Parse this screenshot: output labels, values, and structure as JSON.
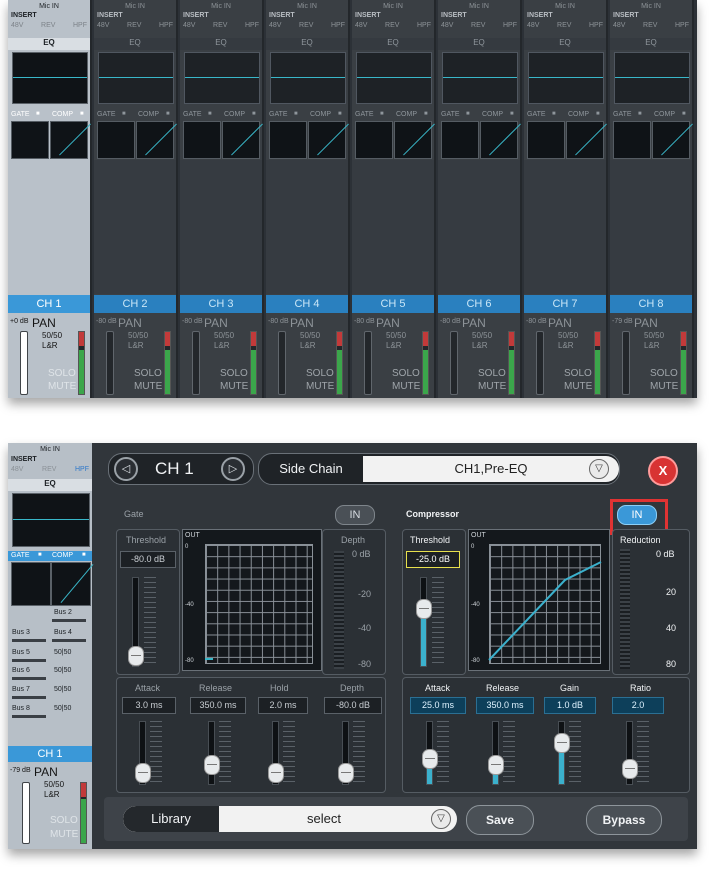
{
  "mixer": {
    "channels": [
      {
        "mic": "Mic IN",
        "insert": "INSERT",
        "v48": "48V",
        "rev": "REV",
        "hpf": "HPF",
        "eq": "EQ",
        "gate": "GATE",
        "comp": "COMP",
        "name": "CH 1",
        "db": "+0 dB",
        "pan": "PAN",
        "pan_val": "50/50",
        "pan_lr": "L&R",
        "solo": "SOLO",
        "mute": "MUTE"
      },
      {
        "mic": "Mic IN",
        "insert": "INSERT",
        "v48": "48V",
        "rev": "REV",
        "hpf": "HPF",
        "eq": "EQ",
        "gate": "GATE",
        "comp": "COMP",
        "name": "CH 2",
        "db": "-80 dB",
        "pan": "PAN",
        "pan_val": "50/50",
        "pan_lr": "L&R",
        "solo": "SOLO",
        "mute": "MUTE"
      },
      {
        "mic": "Mic IN",
        "insert": "INSERT",
        "v48": "48V",
        "rev": "REV",
        "hpf": "HPF",
        "eq": "EQ",
        "gate": "GATE",
        "comp": "COMP",
        "name": "CH 3",
        "db": "-80 dB",
        "pan": "PAN",
        "pan_val": "50/50",
        "pan_lr": "L&R",
        "solo": "SOLO",
        "mute": "MUTE"
      },
      {
        "mic": "Mic IN",
        "insert": "INSERT",
        "v48": "48V",
        "rev": "REV",
        "hpf": "HPF",
        "eq": "EQ",
        "gate": "GATE",
        "comp": "COMP",
        "name": "CH 4",
        "db": "-80 dB",
        "pan": "PAN",
        "pan_val": "50/50",
        "pan_lr": "L&R",
        "solo": "SOLO",
        "mute": "MUTE"
      },
      {
        "mic": "Mic IN",
        "insert": "INSERT",
        "v48": "48V",
        "rev": "REV",
        "hpf": "HPF",
        "eq": "EQ",
        "gate": "GATE",
        "comp": "COMP",
        "name": "CH 5",
        "db": "-80 dB",
        "pan": "PAN",
        "pan_val": "50/50",
        "pan_lr": "L&R",
        "solo": "SOLO",
        "mute": "MUTE"
      },
      {
        "mic": "Mic IN",
        "insert": "INSERT",
        "v48": "48V",
        "rev": "REV",
        "hpf": "HPF",
        "eq": "EQ",
        "gate": "GATE",
        "comp": "COMP",
        "name": "CH 6",
        "db": "-80 dB",
        "pan": "PAN",
        "pan_val": "50/50",
        "pan_lr": "L&R",
        "solo": "SOLO",
        "mute": "MUTE"
      },
      {
        "mic": "Mic IN",
        "insert": "INSERT",
        "v48": "48V",
        "rev": "REV",
        "hpf": "HPF",
        "eq": "EQ",
        "gate": "GATE",
        "comp": "COMP",
        "name": "CH 7",
        "db": "-80 dB",
        "pan": "PAN",
        "pan_val": "50/50",
        "pan_lr": "L&R",
        "solo": "SOLO",
        "mute": "MUTE"
      },
      {
        "mic": "Mic IN",
        "insert": "INSERT",
        "v48": "48V",
        "rev": "REV",
        "hpf": "HPF",
        "eq": "EQ",
        "gate": "GATE",
        "comp": "COMP",
        "name": "CH 8",
        "db": "-79 dB",
        "pan": "PAN",
        "pan_val": "50/50",
        "pan_lr": "L&R",
        "solo": "SOLO",
        "mute": "MUTE"
      }
    ]
  },
  "side": {
    "mic": "Mic IN",
    "insert": "INSERT",
    "v48": "48V",
    "rev": "REV",
    "hpf": "HPF",
    "eq": "EQ",
    "gate": "GATE",
    "comp": "COMP",
    "buses": [
      "Bus 2",
      "Bus 3",
      "Bus 4",
      "Bus 5",
      "50|50",
      "Bus 6",
      "50|50",
      "Bus 7",
      "50|50",
      "Bus 8",
      "50|50"
    ],
    "name": "CH 1",
    "db": "-79 dB",
    "pan": "PAN",
    "pan_val": "50/50",
    "pan_lr": "L&R",
    "solo": "SOLO",
    "mute": "MUTE"
  },
  "header": {
    "channel": "CH 1",
    "prev_icon": "triangle-left-icon",
    "next_icon": "triangle-right-icon",
    "sidechain_label": "Side Chain",
    "sidechain_value": "CH1,Pre-EQ",
    "close_label": "X"
  },
  "gate": {
    "title": "Gate",
    "in": "IN",
    "threshold_label": "Threshold",
    "threshold": "-80.0 dB",
    "out": "OUT",
    "g0": "0",
    "g40": "-40",
    "g80": "-80",
    "depth_label": "Depth",
    "d0": "0 dB",
    "d20": "-20",
    "d40": "-40",
    "d80": "-80",
    "attack_label": "Attack",
    "attack": "3.0 ms",
    "release_label": "Release",
    "release": "350.0 ms",
    "hold_label": "Hold",
    "hold": "2.0 ms",
    "depth2_label": "Depth",
    "depth2": "-80.0 dB"
  },
  "compressor": {
    "title": "Compressor",
    "in": "IN",
    "threshold_label": "Threshold",
    "threshold": "-25.0 dB",
    "out": "OUT",
    "g0": "0",
    "g40": "-40",
    "g80": "-80",
    "reduction_label": "Reduction",
    "r0": "0 dB",
    "r20": "20",
    "r40": "40",
    "r80": "80",
    "attack_label": "Attack",
    "attack": "25.0 ms",
    "release_label": "Release",
    "release": "350.0 ms",
    "gain_label": "Gain",
    "gain": "1.0 dB",
    "ratio_label": "Ratio",
    "ratio": "2.0"
  },
  "footer": {
    "library": "Library",
    "select": "select",
    "save": "Save",
    "bypass": "Bypass"
  }
}
